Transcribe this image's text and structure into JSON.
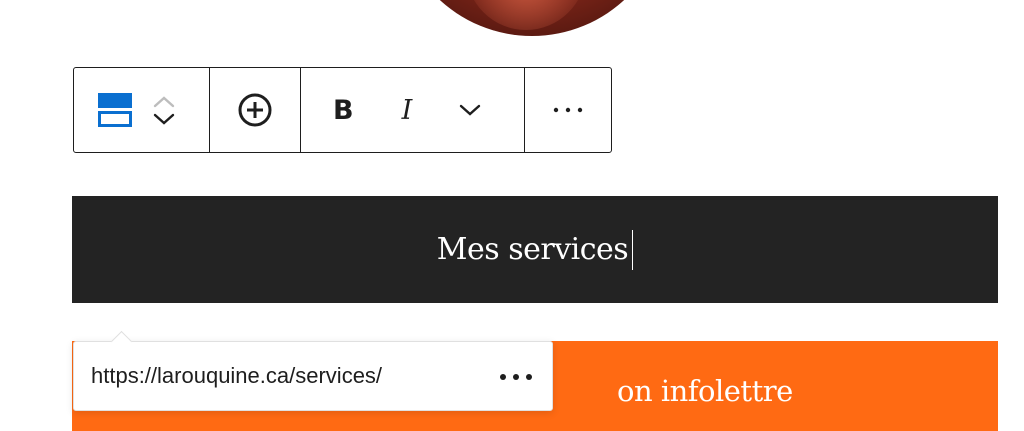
{
  "toolbar": {
    "block_type_icon": "group-block-icon",
    "move_up_icon": "chevron-up-icon",
    "move_down_icon": "chevron-down-icon",
    "add_icon": "plus-circle-icon",
    "bold_label": "B",
    "italic_label": "I",
    "more_format_icon": "chevron-down-icon",
    "options_label": "⋯",
    "accent_color": "#0a6fd0"
  },
  "banner": {
    "heading": "Mes services",
    "background": "#232323"
  },
  "cta": {
    "text": "on infolettre",
    "background": "#ff6a13"
  },
  "link_popover": {
    "url": "https://larouquine.ca/services/",
    "more_icon": "more-dots-icon"
  }
}
